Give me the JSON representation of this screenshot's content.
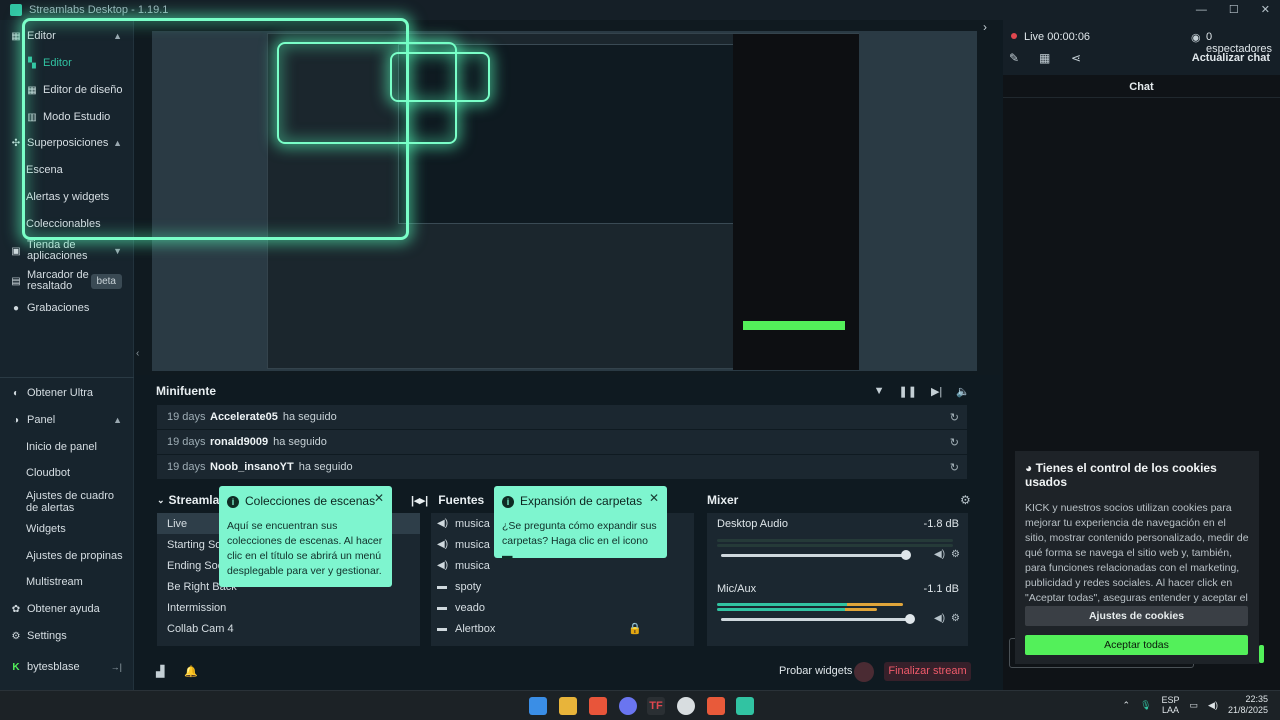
{
  "window": {
    "title": "Streamlabs Desktop - 1.19.1"
  },
  "sidebar": {
    "editor_section": "Editor",
    "items": [
      {
        "label": "Editor"
      },
      {
        "label": "Editor de diseño"
      },
      {
        "label": "Modo Estudio"
      }
    ],
    "overlays_section": "Superposiciones",
    "overlay_items": [
      {
        "label": "Escena"
      },
      {
        "label": "Alertas y widgets"
      },
      {
        "label": "Coleccionables"
      }
    ],
    "app_store": "Tienda de aplicaciones",
    "highlighter": "Marcador de resaltado",
    "beta": "beta",
    "recordings": "Grabaciones",
    "ultra": "Obtener Ultra",
    "panel_section": "Panel",
    "panel_items": [
      {
        "label": "Inicio de panel"
      },
      {
        "label": "Cloudbot"
      },
      {
        "label": "Ajustes de cuadro de alertas"
      },
      {
        "label": "Widgets"
      },
      {
        "label": "Ajustes de propinas"
      },
      {
        "label": "Multistream"
      }
    ],
    "help": "Obtener ayuda",
    "settings": "Settings",
    "user": "bytesblase"
  },
  "minifeed": {
    "title": "Minifuente",
    "events": [
      {
        "ago": "19 days",
        "user": "Accelerate05",
        "action": "ha seguido"
      },
      {
        "ago": "19 days",
        "user": "ronald9009",
        "action": "ha seguido"
      },
      {
        "ago": "19 days",
        "user": "Noob_insanoYT",
        "action": "ha seguido"
      }
    ]
  },
  "scenes": {
    "title": "Streamlabs",
    "items": [
      {
        "label": "Live"
      },
      {
        "label": "Starting Soon"
      },
      {
        "label": "Ending Soon"
      },
      {
        "label": "Be Right Back"
      },
      {
        "label": "Intermission"
      },
      {
        "label": "Collab Cam 4"
      }
    ]
  },
  "sources": {
    "title": "Fuentes",
    "items": [
      {
        "label": "musica",
        "icon": "speaker-icon"
      },
      {
        "label": "musica",
        "icon": "speaker-icon"
      },
      {
        "label": "musica",
        "icon": "speaker-icon"
      },
      {
        "label": "spoty",
        "icon": "folder-icon"
      },
      {
        "label": "veado",
        "icon": "folder-icon"
      },
      {
        "label": "Alertbox",
        "icon": "folder-icon"
      }
    ]
  },
  "mixer": {
    "title": "Mixer",
    "channels": [
      {
        "name": "Desktop Audio",
        "db": "-1.8 dB"
      },
      {
        "name": "Mic/Aux",
        "db": "-1.1 dB"
      }
    ]
  },
  "tooltips": {
    "scenes": {
      "title": "Colecciones de escenas",
      "body": "Aquí se encuentran sus colecciones de escenas. Al hacer clic en el título se abrirá un menú desplegable para ver y gestionar."
    },
    "folders": {
      "title": "Expansión de carpetas",
      "body": "¿Se pregunta cómo expandir sus carpetas? Haga clic en el icono"
    }
  },
  "footer": {
    "test_widgets": "Probar widgets",
    "end_stream": "Finalizar stream"
  },
  "right_panel": {
    "live": "Live 00:00:06",
    "viewers": "0 espectadores",
    "refresh_chat": "Actualizar chat",
    "chat": "Chat"
  },
  "cookie": {
    "title": "Tienes el control de los cookies usados",
    "body": "KICK y nuestros socios utilizan cookies para mejorar tu experiencia de navegación en el sitio, mostrar contenido personalizado, medir de qué forma se navega el sitio web y, también, para funciones relacionadas con el marketing, publicidad y redes sociales. Al hacer click en \"Aceptar todas\", aseguras entender y aceptar el uso de nuestras cookies.",
    "settings_button": "Ajustes de cookies",
    "accept_button": "Aceptar todas"
  },
  "taskbar": {
    "lang": "ESP",
    "lang2": "LAA",
    "time": "22:35",
    "date": "21/8/2025"
  },
  "colors": {
    "accent": "#31c3a2",
    "glow": "#7affc8",
    "tooltip": "#7ef5cf",
    "kick_green": "#53f05a",
    "danger": "#ef5a6a"
  }
}
